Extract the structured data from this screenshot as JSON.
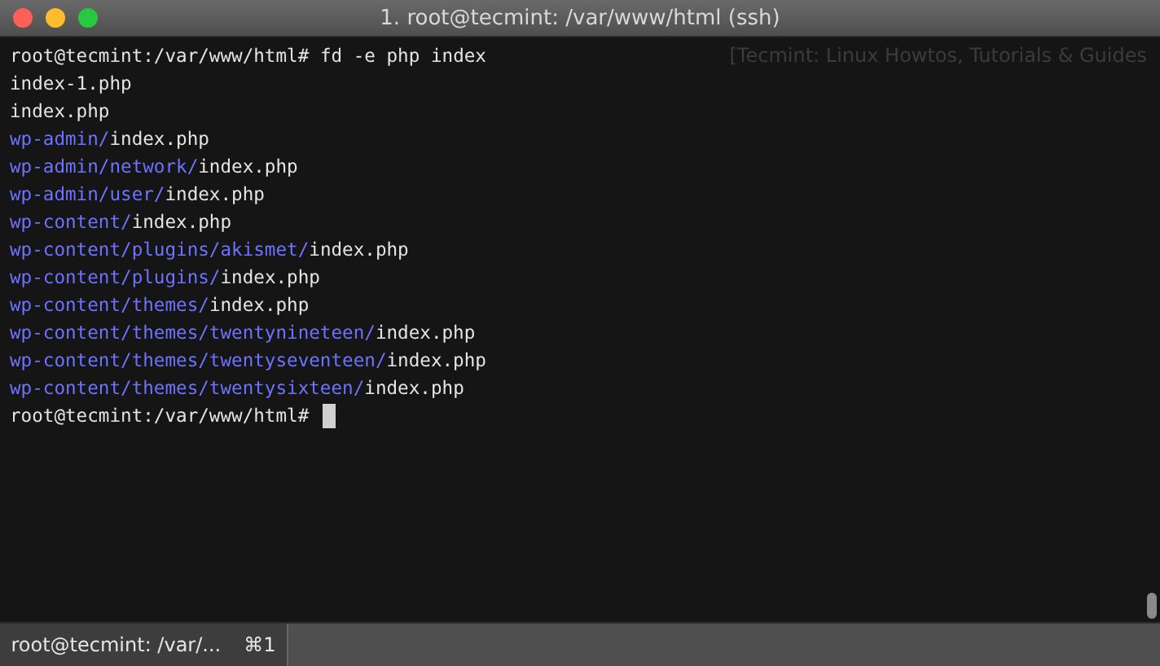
{
  "window": {
    "title": "1. root@tecmint: /var/www/html (ssh)"
  },
  "background_text": "[Tecmint: Linux Howtos, Tutorials & Guides",
  "command": {
    "prompt": "root@tecmint:/var/www/html#",
    "input": "fd -e php index"
  },
  "output": [
    {
      "file": "index-1.php"
    },
    {
      "file": "index.php"
    },
    {
      "dir": "wp-admin/",
      "file": "index.php"
    },
    {
      "dir": "wp-admin/network/",
      "file": "index.php"
    },
    {
      "dir": "wp-admin/user/",
      "file": "index.php"
    },
    {
      "dir": "wp-content/",
      "file": "index.php"
    },
    {
      "dir": "wp-content/plugins/akismet/",
      "file": "index.php"
    },
    {
      "dir": "wp-content/plugins/",
      "file": "index.php"
    },
    {
      "dir": "wp-content/themes/",
      "file": "index.php"
    },
    {
      "dir": "wp-content/themes/twentynineteen/",
      "file": "index.php"
    },
    {
      "dir": "wp-content/themes/twentyseventeen/",
      "file": "index.php"
    },
    {
      "dir": "wp-content/themes/twentysixteen/",
      "file": "index.php"
    }
  ],
  "final_prompt": "root@tecmint:/var/www/html#",
  "tabs": [
    {
      "label": "root@tecmint: /var/...",
      "shortcut": "⌘1",
      "selected": true
    }
  ]
}
